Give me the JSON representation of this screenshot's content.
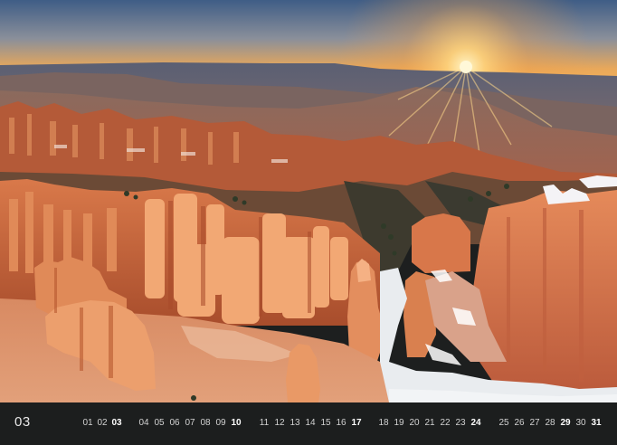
{
  "calendar": {
    "month_number": "03",
    "days": [
      {
        "label": "01",
        "bold": false
      },
      {
        "label": "02",
        "bold": false
      },
      {
        "label": "03",
        "bold": true
      },
      {
        "label": "04",
        "bold": false
      },
      {
        "label": "05",
        "bold": false
      },
      {
        "label": "06",
        "bold": false
      },
      {
        "label": "07",
        "bold": false
      },
      {
        "label": "08",
        "bold": false
      },
      {
        "label": "09",
        "bold": false
      },
      {
        "label": "10",
        "bold": true
      },
      {
        "label": "11",
        "bold": false
      },
      {
        "label": "12",
        "bold": false
      },
      {
        "label": "13",
        "bold": false
      },
      {
        "label": "14",
        "bold": false
      },
      {
        "label": "15",
        "bold": false
      },
      {
        "label": "16",
        "bold": false
      },
      {
        "label": "17",
        "bold": true
      },
      {
        "label": "18",
        "bold": false
      },
      {
        "label": "19",
        "bold": false
      },
      {
        "label": "20",
        "bold": false
      },
      {
        "label": "21",
        "bold": false
      },
      {
        "label": "22",
        "bold": false
      },
      {
        "label": "23",
        "bold": false
      },
      {
        "label": "24",
        "bold": true
      },
      {
        "label": "25",
        "bold": false
      },
      {
        "label": "26",
        "bold": false
      },
      {
        "label": "27",
        "bold": false
      },
      {
        "label": "28",
        "bold": false
      },
      {
        "label": "29",
        "bold": true
      },
      {
        "label": "30",
        "bold": false
      },
      {
        "label": "31",
        "bold": true
      }
    ]
  },
  "colors": {
    "strip_background": "#1c1e1e",
    "sky_top": "#3f5d86",
    "sky_horizon": "#f2b15a",
    "sun": "#fff4c2",
    "rock": "#c8643a",
    "snow": "#eef0f2"
  }
}
